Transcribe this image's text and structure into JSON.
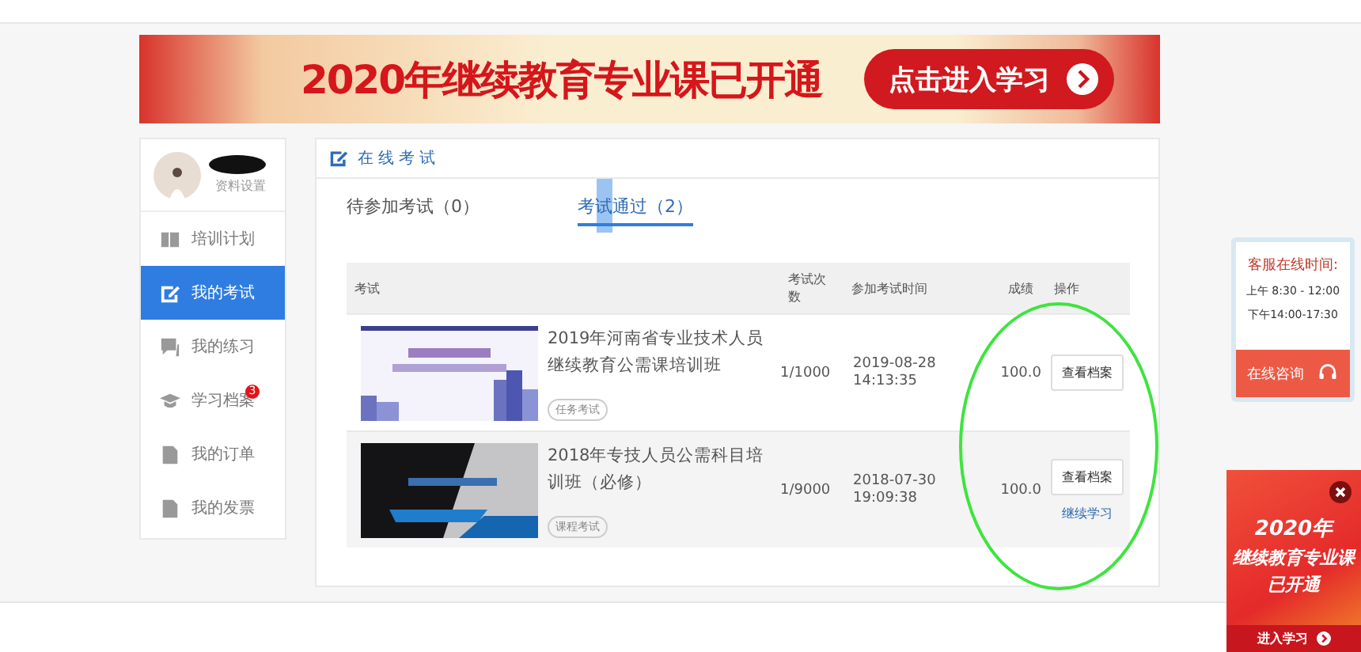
{
  "banner": {
    "headline": "2020年继续教育专业课已开通",
    "button": "点击进入学习"
  },
  "profile": {
    "settings_link": "资料设置"
  },
  "sidebar": {
    "items": [
      {
        "label": "培训计划",
        "kind": "book",
        "selected": false
      },
      {
        "label": "我的考试",
        "kind": "edit",
        "selected": true
      },
      {
        "label": "我的练习",
        "kind": "chat",
        "selected": false
      },
      {
        "label": "学习档案",
        "kind": "cap",
        "selected": false,
        "badge": "3"
      },
      {
        "label": "我的订单",
        "kind": "doc",
        "selected": false
      },
      {
        "label": "我的发票",
        "kind": "doc",
        "selected": false
      }
    ]
  },
  "main": {
    "title": "在线考试",
    "tabs": [
      {
        "label": "待参加考试（0）",
        "selected": false
      },
      {
        "label": "考试通过（2）",
        "selected": true
      }
    ],
    "table": {
      "columns": [
        "考试",
        "考试次数",
        "参加考试时间",
        "成绩",
        "操作"
      ],
      "rows": [
        {
          "title": "2019年河南省专业技术人员继续教育公需课培训班",
          "tag": "任务考试",
          "attempts": "1/1000",
          "date": "2019-08-28",
          "time": "14:13:35",
          "score": "100.0",
          "action": "查看档案"
        },
        {
          "title": "2018年专技人员公需科目培训班（必修）",
          "tag": "课程考试",
          "attempts": "1/9000",
          "date": "2018-07-30",
          "time": "19:09:38",
          "score": "100.0",
          "action": "查看档案",
          "link": "继续学习"
        }
      ]
    }
  },
  "support": {
    "title": "客服在线时间:",
    "hours": [
      "上午 8:30 - 12:00",
      "下午14:00-17:30"
    ],
    "button": "在线咨询"
  },
  "ad": {
    "headline": [
      "2020年",
      "继续教育专业课",
      "已开通"
    ],
    "button": "进入学习"
  }
}
